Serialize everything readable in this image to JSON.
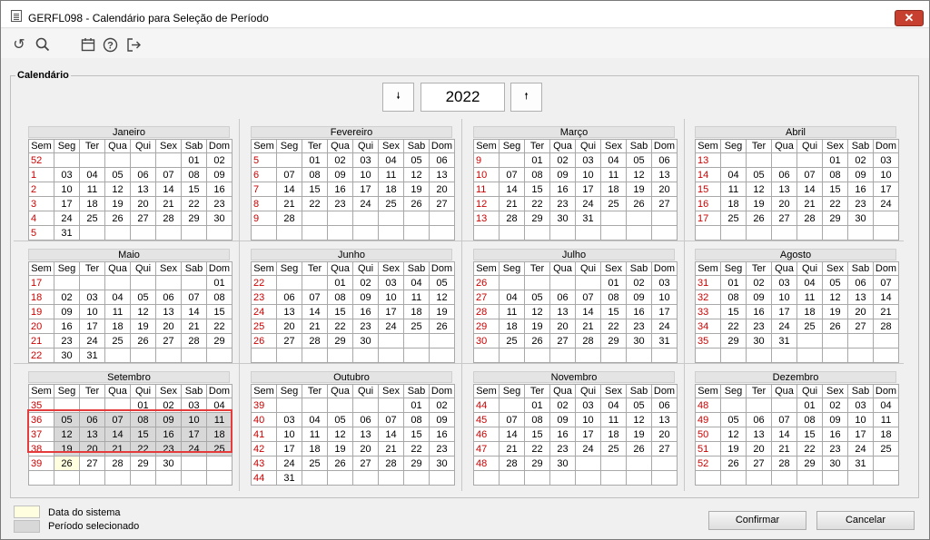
{
  "window": {
    "title": "GERFL098 - Calendário para Seleção de Período",
    "close_label": "✕"
  },
  "toolbar": {
    "icons": [
      "undo-icon",
      "search-icon",
      "calendar-icon",
      "help-icon",
      "exit-icon"
    ]
  },
  "legend": "Calendário",
  "year": {
    "prev_label": "🠗",
    "value": "2022",
    "next_label": "🠕"
  },
  "weekday_headers": [
    "Sem",
    "Seg",
    "Ter",
    "Qua",
    "Qui",
    "Sex",
    "Sab",
    "Dom"
  ],
  "months": [
    {
      "name": "Janeiro",
      "rows": [
        [
          "52",
          "",
          "",
          "",
          "",
          "",
          "01",
          "02"
        ],
        [
          "1",
          "03",
          "04",
          "05",
          "06",
          "07",
          "08",
          "09"
        ],
        [
          "2",
          "10",
          "11",
          "12",
          "13",
          "14",
          "15",
          "16"
        ],
        [
          "3",
          "17",
          "18",
          "19",
          "20",
          "21",
          "22",
          "23"
        ],
        [
          "4",
          "24",
          "25",
          "26",
          "27",
          "28",
          "29",
          "30"
        ],
        [
          "5",
          "31",
          "",
          "",
          "",
          "",
          "",
          ""
        ]
      ]
    },
    {
      "name": "Fevereiro",
      "rows": [
        [
          "5",
          "",
          "01",
          "02",
          "03",
          "04",
          "05",
          "06"
        ],
        [
          "6",
          "07",
          "08",
          "09",
          "10",
          "11",
          "12",
          "13"
        ],
        [
          "7",
          "14",
          "15",
          "16",
          "17",
          "18",
          "19",
          "20"
        ],
        [
          "8",
          "21",
          "22",
          "23",
          "24",
          "25",
          "26",
          "27"
        ],
        [
          "9",
          "28",
          "",
          "",
          "",
          "",
          "",
          ""
        ],
        [
          "",
          "",
          "",
          "",
          "",
          "",
          "",
          ""
        ]
      ]
    },
    {
      "name": "Março",
      "rows": [
        [
          "9",
          "",
          "01",
          "02",
          "03",
          "04",
          "05",
          "06"
        ],
        [
          "10",
          "07",
          "08",
          "09",
          "10",
          "11",
          "12",
          "13"
        ],
        [
          "11",
          "14",
          "15",
          "16",
          "17",
          "18",
          "19",
          "20"
        ],
        [
          "12",
          "21",
          "22",
          "23",
          "24",
          "25",
          "26",
          "27"
        ],
        [
          "13",
          "28",
          "29",
          "30",
          "31",
          "",
          "",
          ""
        ],
        [
          "",
          "",
          "",
          "",
          "",
          "",
          "",
          ""
        ]
      ]
    },
    {
      "name": "Abril",
      "rows": [
        [
          "13",
          "",
          "",
          "",
          "",
          "01",
          "02",
          "03"
        ],
        [
          "14",
          "04",
          "05",
          "06",
          "07",
          "08",
          "09",
          "10"
        ],
        [
          "15",
          "11",
          "12",
          "13",
          "14",
          "15",
          "16",
          "17"
        ],
        [
          "16",
          "18",
          "19",
          "20",
          "21",
          "22",
          "23",
          "24"
        ],
        [
          "17",
          "25",
          "26",
          "27",
          "28",
          "29",
          "30",
          ""
        ],
        [
          "",
          "",
          "",
          "",
          "",
          "",
          "",
          ""
        ]
      ]
    },
    {
      "name": "Maio",
      "rows": [
        [
          "17",
          "",
          "",
          "",
          "",
          "",
          "",
          "01"
        ],
        [
          "18",
          "02",
          "03",
          "04",
          "05",
          "06",
          "07",
          "08"
        ],
        [
          "19",
          "09",
          "10",
          "11",
          "12",
          "13",
          "14",
          "15"
        ],
        [
          "20",
          "16",
          "17",
          "18",
          "19",
          "20",
          "21",
          "22"
        ],
        [
          "21",
          "23",
          "24",
          "25",
          "26",
          "27",
          "28",
          "29"
        ],
        [
          "22",
          "30",
          "31",
          "",
          "",
          "",
          "",
          ""
        ]
      ]
    },
    {
      "name": "Junho",
      "rows": [
        [
          "22",
          "",
          "",
          "01",
          "02",
          "03",
          "04",
          "05"
        ],
        [
          "23",
          "06",
          "07",
          "08",
          "09",
          "10",
          "11",
          "12"
        ],
        [
          "24",
          "13",
          "14",
          "15",
          "16",
          "17",
          "18",
          "19"
        ],
        [
          "25",
          "20",
          "21",
          "22",
          "23",
          "24",
          "25",
          "26"
        ],
        [
          "26",
          "27",
          "28",
          "29",
          "30",
          "",
          "",
          ""
        ],
        [
          "",
          "",
          "",
          "",
          "",
          "",
          "",
          ""
        ]
      ]
    },
    {
      "name": "Julho",
      "rows": [
        [
          "26",
          "",
          "",
          "",
          "",
          "01",
          "02",
          "03"
        ],
        [
          "27",
          "04",
          "05",
          "06",
          "07",
          "08",
          "09",
          "10"
        ],
        [
          "28",
          "11",
          "12",
          "13",
          "14",
          "15",
          "16",
          "17"
        ],
        [
          "29",
          "18",
          "19",
          "20",
          "21",
          "22",
          "23",
          "24"
        ],
        [
          "30",
          "25",
          "26",
          "27",
          "28",
          "29",
          "30",
          "31"
        ],
        [
          "",
          "",
          "",
          "",
          "",
          "",
          "",
          ""
        ]
      ]
    },
    {
      "name": "Agosto",
      "rows": [
        [
          "31",
          "01",
          "02",
          "03",
          "04",
          "05",
          "06",
          "07"
        ],
        [
          "32",
          "08",
          "09",
          "10",
          "11",
          "12",
          "13",
          "14"
        ],
        [
          "33",
          "15",
          "16",
          "17",
          "18",
          "19",
          "20",
          "21"
        ],
        [
          "34",
          "22",
          "23",
          "24",
          "25",
          "26",
          "27",
          "28"
        ],
        [
          "35",
          "29",
          "30",
          "31",
          "",
          "",
          "",
          ""
        ],
        [
          "",
          "",
          "",
          "",
          "",
          "",
          "",
          ""
        ]
      ]
    },
    {
      "name": "Setembro",
      "rows": [
        [
          "35",
          "",
          "",
          "",
          "01",
          "02",
          "03",
          "04"
        ],
        [
          "36",
          "05",
          "06",
          "07",
          "08",
          "09",
          "10",
          "11"
        ],
        [
          "37",
          "12",
          "13",
          "14",
          "15",
          "16",
          "17",
          "18"
        ],
        [
          "38",
          "19",
          "20",
          "21",
          "22",
          "23",
          "24",
          "25"
        ],
        [
          "39",
          "26",
          "27",
          "28",
          "29",
          "30",
          "",
          ""
        ],
        [
          "",
          "",
          "",
          "",
          "",
          "",
          "",
          ""
        ]
      ],
      "selected_weeks": [
        1,
        2,
        3
      ],
      "today": {
        "row": 4,
        "col": 1
      }
    },
    {
      "name": "Outubro",
      "rows": [
        [
          "39",
          "",
          "",
          "",
          "",
          "",
          "01",
          "02"
        ],
        [
          "40",
          "03",
          "04",
          "05",
          "06",
          "07",
          "08",
          "09"
        ],
        [
          "41",
          "10",
          "11",
          "12",
          "13",
          "14",
          "15",
          "16"
        ],
        [
          "42",
          "17",
          "18",
          "19",
          "20",
          "21",
          "22",
          "23"
        ],
        [
          "43",
          "24",
          "25",
          "26",
          "27",
          "28",
          "29",
          "30"
        ],
        [
          "44",
          "31",
          "",
          "",
          "",
          "",
          "",
          ""
        ]
      ]
    },
    {
      "name": "Novembro",
      "rows": [
        [
          "44",
          "",
          "01",
          "02",
          "03",
          "04",
          "05",
          "06"
        ],
        [
          "45",
          "07",
          "08",
          "09",
          "10",
          "11",
          "12",
          "13"
        ],
        [
          "46",
          "14",
          "15",
          "16",
          "17",
          "18",
          "19",
          "20"
        ],
        [
          "47",
          "21",
          "22",
          "23",
          "24",
          "25",
          "26",
          "27"
        ],
        [
          "48",
          "28",
          "29",
          "30",
          "",
          "",
          "",
          ""
        ],
        [
          "",
          "",
          "",
          "",
          "",
          "",
          "",
          ""
        ]
      ]
    },
    {
      "name": "Dezembro",
      "rows": [
        [
          "48",
          "",
          "",
          "",
          "01",
          "02",
          "03",
          "04"
        ],
        [
          "49",
          "05",
          "06",
          "07",
          "08",
          "09",
          "10",
          "11"
        ],
        [
          "50",
          "12",
          "13",
          "14",
          "15",
          "16",
          "17",
          "18"
        ],
        [
          "51",
          "19",
          "20",
          "21",
          "22",
          "23",
          "24",
          "25"
        ],
        [
          "52",
          "26",
          "27",
          "28",
          "29",
          "30",
          "31",
          ""
        ],
        [
          "",
          "",
          "",
          "",
          "",
          "",
          "",
          ""
        ]
      ]
    }
  ],
  "legend_items": {
    "system_date": "Data do sistema",
    "selected_period": "Período selecionado"
  },
  "colors": {
    "today": "#ffffe0",
    "selected": "#d8d8d8",
    "week_number": "#cc0000",
    "selection_border": "#e43c3c"
  },
  "buttons": {
    "confirm": "Confirmar",
    "cancel": "Cancelar"
  }
}
